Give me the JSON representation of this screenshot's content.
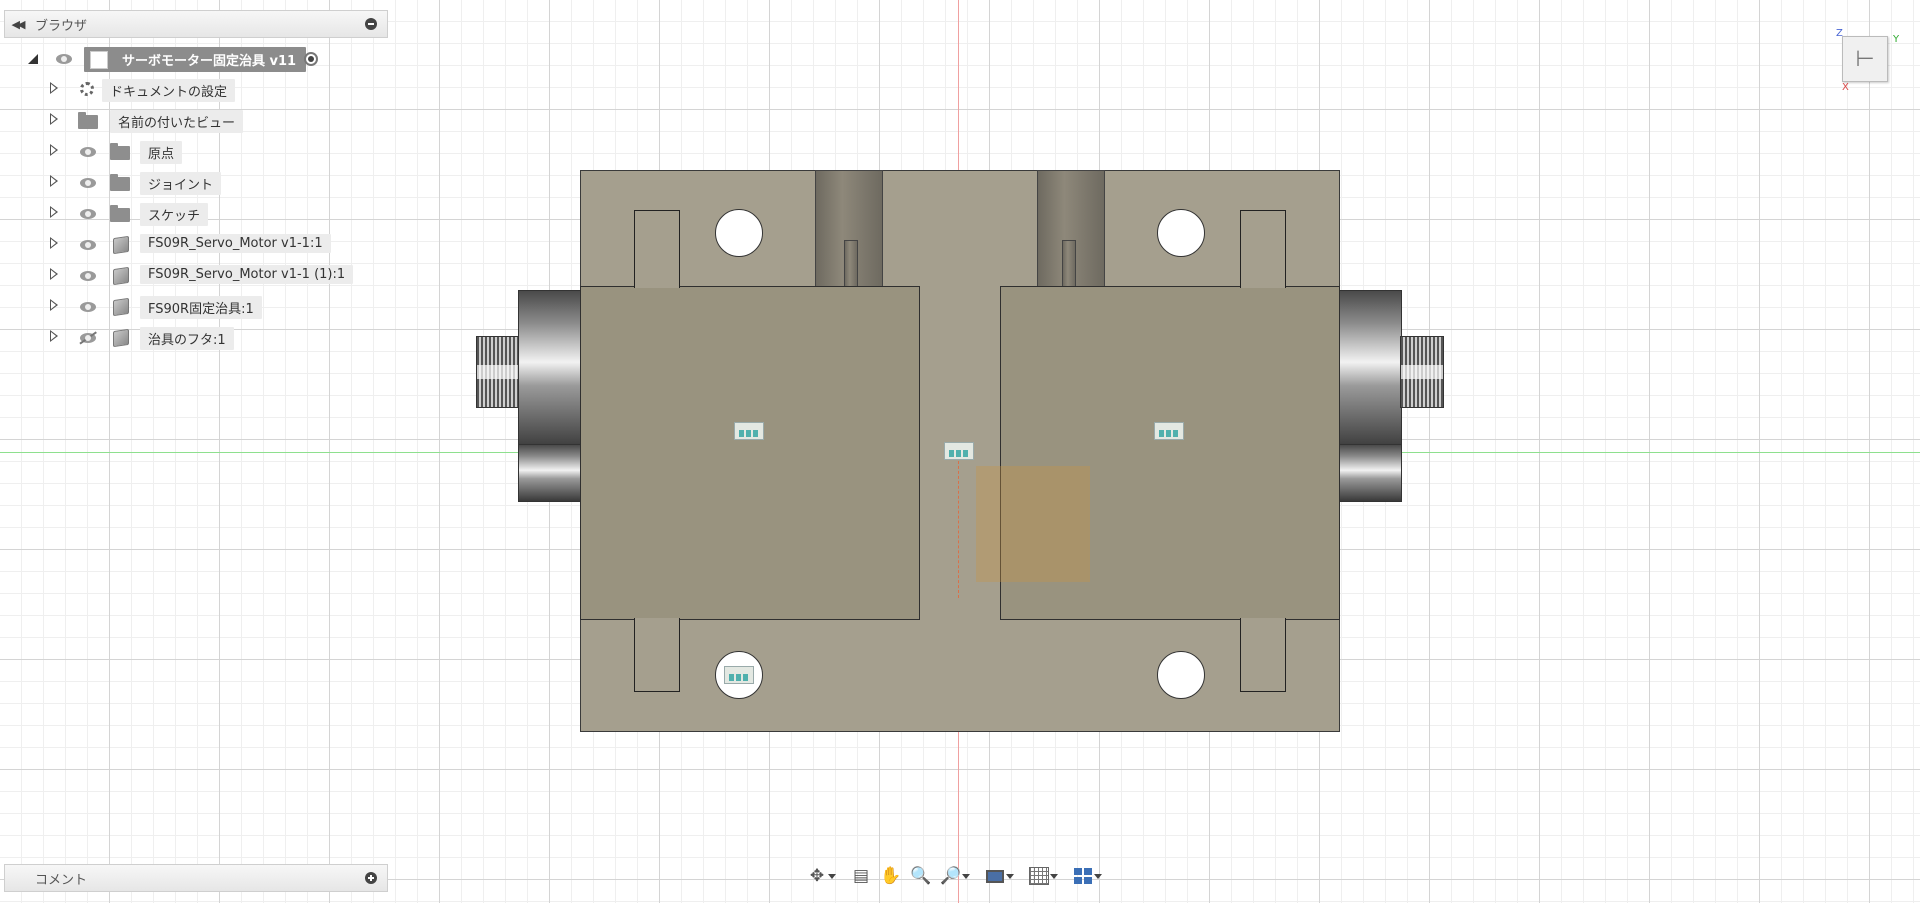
{
  "browser": {
    "title": "ブラウザ",
    "root": "サーボモーター固定治具 v11",
    "items": [
      {
        "label": "ドキュメントの設定"
      },
      {
        "label": "名前の付いたビュー"
      },
      {
        "label": "原点"
      },
      {
        "label": "ジョイント"
      },
      {
        "label": "スケッチ"
      },
      {
        "label": "FS09R_Servo_Motor v1-1:1"
      },
      {
        "label": "FS09R_Servo_Motor v1-1 (1):1"
      },
      {
        "label": "FS90R固定治具:1"
      },
      {
        "label": "治具のフタ:1"
      }
    ]
  },
  "comments": {
    "title": "コメント"
  },
  "viewcube": {
    "x": "X",
    "y": "Y",
    "z": "Z"
  },
  "toolbar": {
    "tools": [
      "orbit-icon",
      "look-at-icon",
      "pan-icon",
      "zoom-icon",
      "fit-icon",
      "display-settings-icon",
      "grid-snap-icon",
      "viewports-icon"
    ]
  },
  "colors": {
    "part_fill": "#a59f8e",
    "grid_major": "#d4d4d4",
    "axis_x": "#f0a0a0",
    "axis_y": "#8ee08e"
  }
}
